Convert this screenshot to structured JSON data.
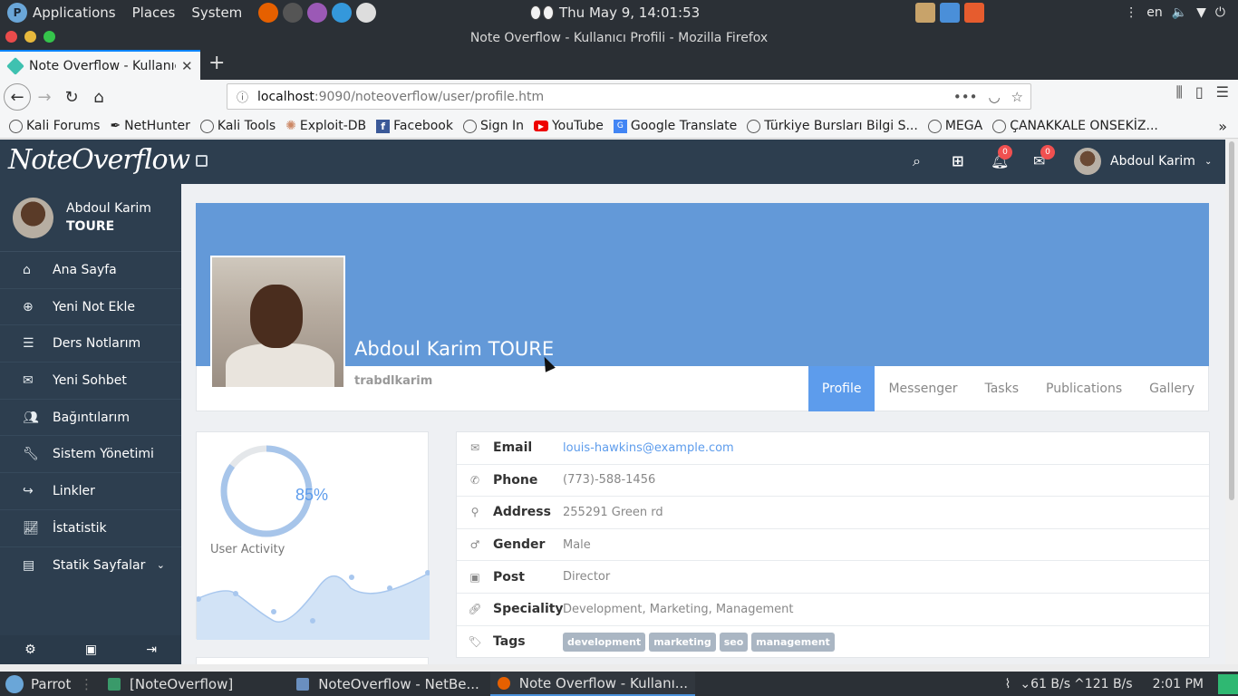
{
  "os_panel": {
    "menus": [
      "Applications",
      "Places",
      "System"
    ],
    "clock": "Thu May  9, 14:01:53",
    "lang": "en"
  },
  "window": {
    "title": "Note Overflow - Kullanıcı Profili - Mozilla Firefox"
  },
  "browser": {
    "tab_title": "Note Overflow - Kullanıcı Profili",
    "url_host": "localhost",
    "url_path": ":9090/noteoverflow/user/profile.htm",
    "bookmarks": [
      "Kali Forums",
      "NetHunter",
      "Kali Tools",
      "Exploit-DB",
      "Facebook",
      "Sign In",
      "YouTube",
      "Google Translate",
      "Türkiye Bursları Bilgi S...",
      "MEGA",
      "ÇANAKKALE ONSEKİZ..."
    ]
  },
  "app": {
    "brand": "NoteOverflow",
    "notifications_count": "0",
    "messages_count": "0",
    "header_user": "Abdoul Karim"
  },
  "sidebar": {
    "user_first": "Abdoul Karim",
    "user_last": "TOURE",
    "items": [
      {
        "label": "Ana Sayfa",
        "icon": "home-icon"
      },
      {
        "label": "Yeni Not Ekle",
        "icon": "plus-circle-icon"
      },
      {
        "label": "Ders Notlarım",
        "icon": "list-icon"
      },
      {
        "label": "Yeni Sohbet",
        "icon": "envelope-icon"
      },
      {
        "label": "Bağıntılarım",
        "icon": "users-icon"
      },
      {
        "label": "Sistem Yönetimi",
        "icon": "wrench-icon"
      },
      {
        "label": "Linkler",
        "icon": "share-icon"
      },
      {
        "label": "İstatistik",
        "icon": "line-chart-icon"
      },
      {
        "label": "Statik Sayfalar",
        "icon": "file-icon"
      }
    ]
  },
  "profile": {
    "full_name": "Abdoul Karim TOURE",
    "username": "trabdlkarim",
    "tabs": [
      "Profile",
      "Messenger",
      "Tasks",
      "Publications",
      "Gallery"
    ],
    "active_tab": "Profile"
  },
  "activity": {
    "percent": 85,
    "percent_label": "85%",
    "label": "User Activity",
    "accent": "#5d9cec"
  },
  "info": {
    "rows": [
      {
        "label": "Email",
        "value": "louis-hawkins@example.com",
        "icon": "envelope-icon"
      },
      {
        "label": "Phone",
        "value": "(773)-588-1456",
        "icon": "phone-icon"
      },
      {
        "label": "Address",
        "value": "255291 Green rd",
        "icon": "map-marker-icon"
      },
      {
        "label": "Gender",
        "value": "Male",
        "icon": "male-icon"
      },
      {
        "label": "Post",
        "value": "Director",
        "icon": "id-card-icon"
      },
      {
        "label": "Speciality",
        "value": "Development, Marketing, Management",
        "icon": "link-icon"
      }
    ],
    "tags_label": "Tags",
    "tags": [
      "development",
      "marketing",
      "seo",
      "management"
    ]
  },
  "taskbar": {
    "start": "Parrot",
    "windows": [
      "[NoteOverflow]",
      "NoteOverflow - NetBe...",
      "Note Overflow - Kullanı..."
    ],
    "net_down": "61 B/s",
    "net_up": "121 B/s",
    "time": "2:01 PM"
  }
}
